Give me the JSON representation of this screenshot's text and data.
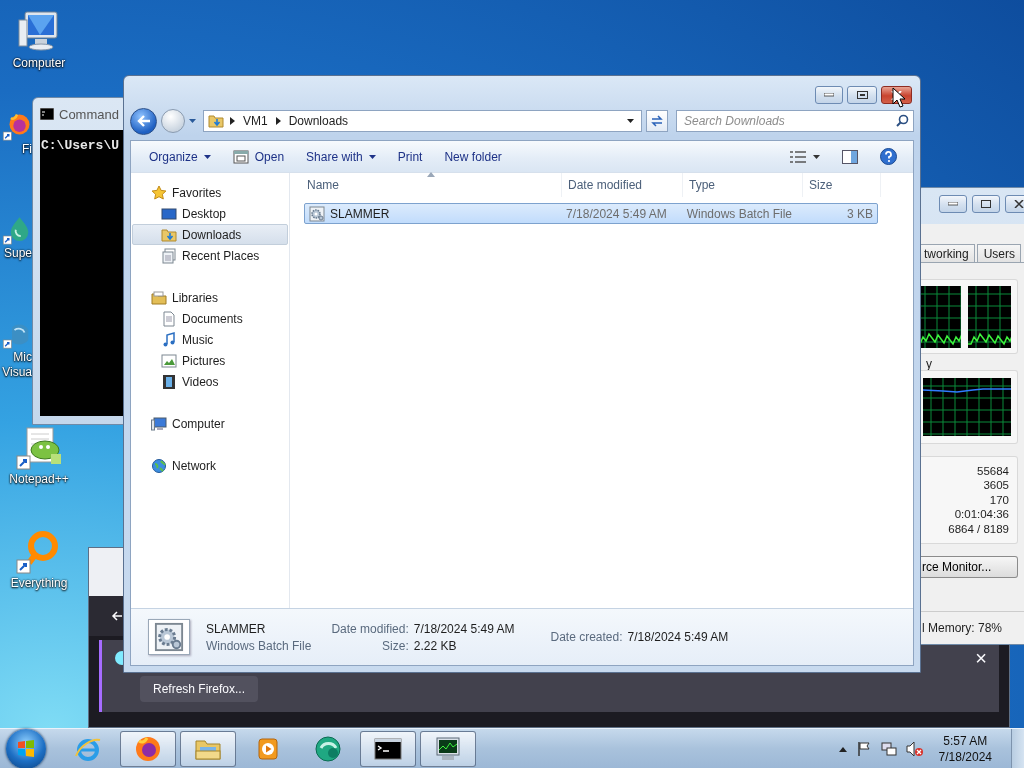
{
  "desktop_icons": [
    {
      "kind": "computer",
      "lines": [
        "Computer"
      ],
      "covered": false
    },
    {
      "kind": "firefox",
      "lines": [
        "Fi"
      ],
      "covered": true
    },
    {
      "kind": "drop",
      "lines": [
        "Supe"
      ],
      "covered": true
    },
    {
      "kind": "studio",
      "lines": [
        "Mic",
        "Visua"
      ],
      "covered": true
    },
    {
      "kind": "notepad",
      "lines": [
        "Notepad++"
      ],
      "covered": false
    },
    {
      "kind": "everything",
      "lines": [
        "Everything"
      ],
      "covered": false
    }
  ],
  "command_window": {
    "title": "Command",
    "text": "C:\\Users\\U"
  },
  "firefox": {
    "close": "×",
    "button": "Refresh Firefox..."
  },
  "task_manager": {
    "tabs": [
      {
        "label": "tworking",
        "selected": false
      },
      {
        "label": "Users",
        "selected": false
      }
    ],
    "memory_label": "y",
    "stats": [
      "55684",
      "3605",
      "170",
      "0:01:04:36",
      "6864 / 8189"
    ],
    "monitor_button": "rce Monitor...",
    "status": "l Memory: 78%"
  },
  "explorer": {
    "breadcrumb": [
      "VM1",
      "Downloads"
    ],
    "search_placeholder": "Search Downloads",
    "toolbar": [
      {
        "label": "Organize",
        "kind": "menu"
      },
      {
        "label": "Open",
        "kind": "open"
      },
      {
        "label": "Share with",
        "kind": "menu"
      },
      {
        "label": "Print",
        "kind": "plain"
      },
      {
        "label": "New folder",
        "kind": "plain"
      }
    ],
    "nav": [
      {
        "label": "Favorites",
        "kind": "star",
        "selected": false,
        "children": [
          {
            "label": "Desktop",
            "kind": "desktop",
            "selected": false
          },
          {
            "label": "Downloads",
            "kind": "downloads",
            "selected": true
          },
          {
            "label": "Recent Places",
            "kind": "recent",
            "selected": false
          }
        ]
      },
      {
        "label": "Libraries",
        "kind": "library",
        "selected": false,
        "children": [
          {
            "label": "Documents",
            "kind": "documents",
            "selected": false
          },
          {
            "label": "Music",
            "kind": "music",
            "selected": false
          },
          {
            "label": "Pictures",
            "kind": "pictures",
            "selected": false
          },
          {
            "label": "Videos",
            "kind": "videos",
            "selected": false
          }
        ]
      },
      {
        "label": "Computer",
        "kind": "computer",
        "selected": false
      },
      {
        "label": "Network",
        "kind": "network",
        "selected": false
      }
    ],
    "columns": [
      "Name",
      "Date modified",
      "Type",
      "Size"
    ],
    "files": [
      {
        "name": "SLAMMER",
        "date_modified": "7/18/2024 5:49 AM",
        "type": "Windows Batch File",
        "size": "3 KB",
        "selected": true
      }
    ],
    "details": {
      "name": "SLAMMER",
      "type": "Windows Batch File",
      "columns": [
        [
          {
            "label": "Date modified:",
            "value": "7/18/2024 5:49 AM"
          },
          {
            "label": "Size:",
            "value": "2.22 KB"
          }
        ],
        [
          {
            "label": "Date created:",
            "value": "7/18/2024 5:49 AM"
          }
        ]
      ]
    }
  },
  "taskbar": {
    "items": [
      {
        "kind": "ie",
        "running": false
      },
      {
        "kind": "firefox",
        "running": true
      },
      {
        "kind": "explorer",
        "running": true
      },
      {
        "kind": "media",
        "running": false
      },
      {
        "kind": "teal",
        "running": false
      },
      {
        "kind": "cmd",
        "running": true
      },
      {
        "kind": "taskmgr",
        "running": true
      }
    ],
    "clock": {
      "time": "5:57 AM",
      "date": "7/18/2024"
    }
  }
}
